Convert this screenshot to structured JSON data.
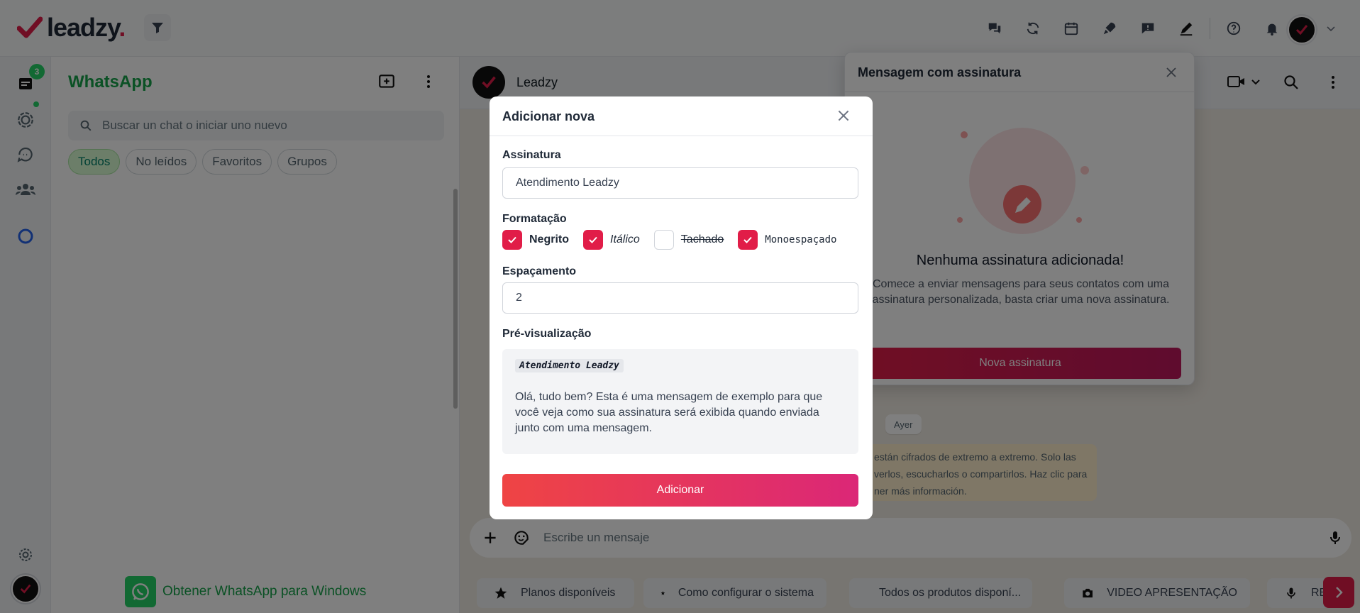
{
  "brand": {
    "name": "leadzy",
    "dot": "."
  },
  "rail": {
    "badge_count": "3"
  },
  "chatlist": {
    "title": "WhatsApp",
    "search_placeholder": "Buscar un chat o iniciar uno nuevo",
    "filters": [
      "Todos",
      "No leídos",
      "Favoritos",
      "Grupos"
    ],
    "active_filter": "Todos",
    "get_app": "Obtener WhatsApp para Windows"
  },
  "chat": {
    "contact_name": "Leadzy",
    "day_label": "Ayer",
    "encryption_note": "están cifrados de extremo a extremo. Solo las ... verlos, escucharlos o compartirlos. Haz clic para ... ner más información.",
    "encryption_lines": [
      "están cifrados de extremo a extremo. Solo las",
      "verlos, escucharlos o compartirlos. Haz clic para",
      "ner más información."
    ],
    "composer_placeholder": "Escribe un mensaje"
  },
  "quick_replies": [
    {
      "icon": "star-icon",
      "label": "Planos disponíveis"
    },
    {
      "icon": "star-icon",
      "label": "Como configurar o sistema"
    },
    {
      "icon": "star-icon",
      "label": "Todos os produtos disponí..."
    },
    {
      "icon": "camera-icon",
      "label": "VIDEO APRESENTAÇÃO"
    },
    {
      "icon": "mic-icon",
      "label": "RE..."
    }
  ],
  "signature_panel": {
    "title": "Mensagem com assinatura",
    "empty_title": "Nenhuma assinatura adicionada!",
    "empty_desc": "Comece a enviar mensagens para seus contatos com uma assinatura personalizada, basta criar uma nova assinatura.",
    "new_button": "Nova assinatura"
  },
  "modal": {
    "title": "Adicionar nova",
    "signature_label": "Assinatura",
    "signature_value": "Atendimento Leadzy",
    "format_label": "Formatação",
    "formats": [
      {
        "label": "Negrito",
        "checked": true
      },
      {
        "label": "Itálico",
        "checked": true
      },
      {
        "label": "Tachado",
        "checked": false
      },
      {
        "label": "Monoespaçado",
        "checked": true
      }
    ],
    "spacing_label": "Espaçamento",
    "spacing_value": "2",
    "preview_label": "Pré-visualização",
    "preview_signature": "Atendimento Leadzy",
    "preview_text": "Olá, tudo bem? Esta é uma mensagem de exemplo para que você veja como sua assinatura será exibida quando enviada junto com uma mensagem.",
    "submit_label": "Adicionar"
  },
  "colors": {
    "accent": "#e11d48",
    "whatsapp_green": "#25d366",
    "overlay": "rgba(0,0,0,0.5)"
  }
}
